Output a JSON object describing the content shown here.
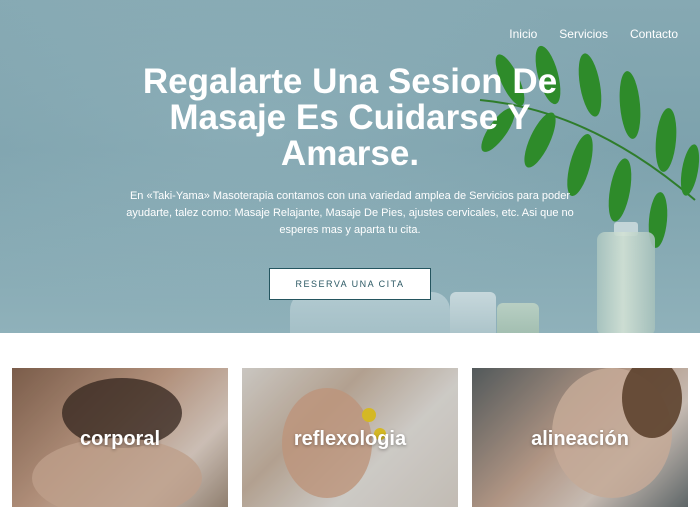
{
  "nav": {
    "items": [
      {
        "label": "Inicio"
      },
      {
        "label": "Servicios"
      },
      {
        "label": "Contacto"
      }
    ]
  },
  "hero": {
    "title": "Regalarte Una Sesion De Masaje Es Cuidarse Y Amarse.",
    "text": "En «Taki-Yama» Masoterapia contamos con una variedad amplea de Servicios para poder ayudarte, talez como: Masaje Relajante, Masaje De Pies, ajustes cervicales, etc. Asi que no esperes mas y aparta tu cita.",
    "cta": "RESERVA UNA CITA"
  },
  "services": [
    {
      "label": "corporal"
    },
    {
      "label": "reflexologia"
    },
    {
      "label": "alineación"
    }
  ],
  "colors": {
    "hero_bg": "#7da2ad",
    "button_border": "#24555f",
    "button_text": "#2c5964",
    "leaf_green": "#2e8b2a"
  },
  "icons": [
    "leaf-branch",
    "oil-bottle",
    "candle",
    "towel"
  ]
}
